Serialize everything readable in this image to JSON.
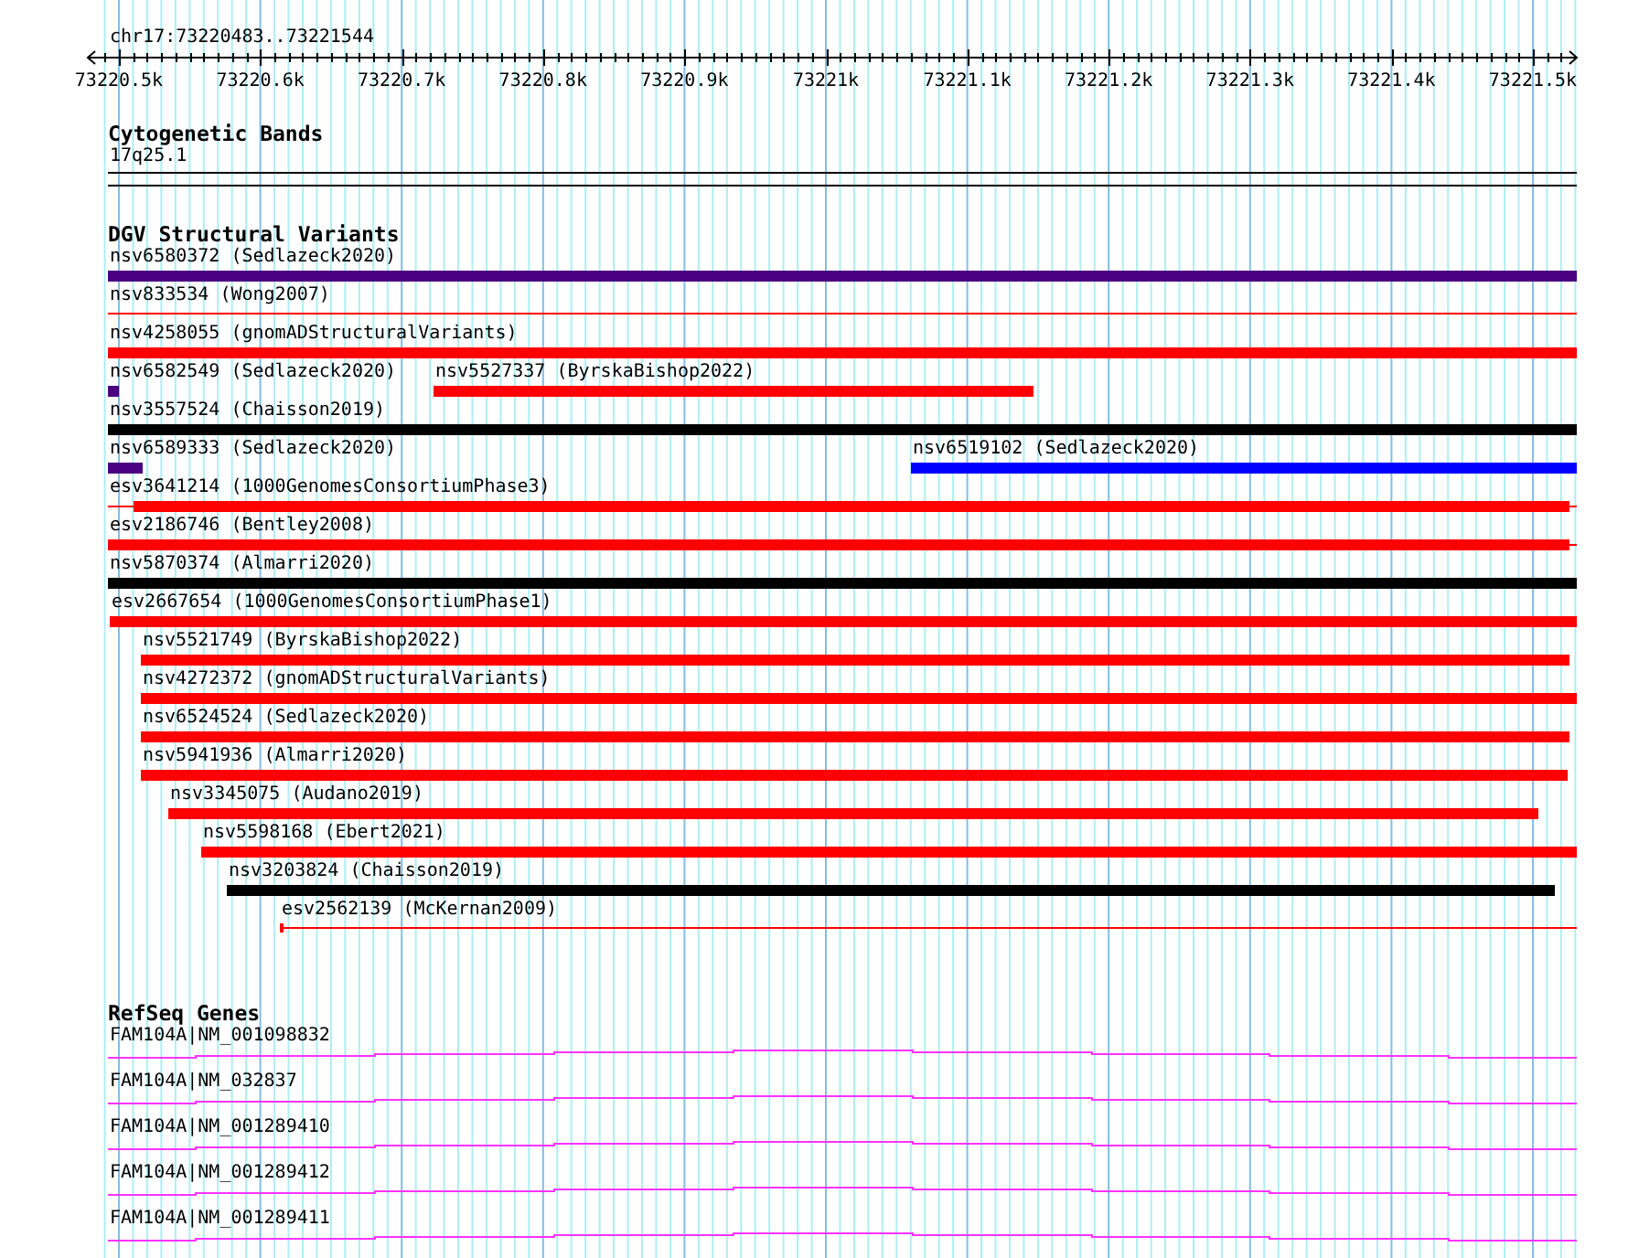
{
  "location": "chr17:73220483..73221544",
  "ruler": {
    "ticks": [
      "73220.5k",
      "73220.6k",
      "73220.7k",
      "73220.8k",
      "73220.9k",
      "73221k",
      "73221.1k",
      "73221.2k",
      "73221.3k",
      "73221.4k",
      "73221.5k"
    ]
  },
  "tracks": [
    {
      "kind": "bands",
      "title": "Cytogenetic Bands",
      "bands": [
        {
          "label": "17q25.1"
        }
      ]
    },
    {
      "kind": "variants",
      "title": "DGV Structural Variants",
      "rows": [
        {
          "features": [
            {
              "label": "nsv6580372 (Sedlazeck2020)",
              "kind": "bar",
              "color": "#4b0082"
            }
          ]
        },
        {
          "features": [
            {
              "label": "nsv833534 (Wong2007)",
              "kind": "line",
              "color": "#ff0000"
            }
          ]
        },
        {
          "features": [
            {
              "label": "nsv4258055 (gnomADStructuralVariants)",
              "kind": "bar",
              "color": "#ff0000"
            }
          ]
        },
        {
          "features": [
            {
              "label": "nsv6582549 (Sedlazeck2020)",
              "kind": "bar",
              "color": "#4b0082"
            },
            {
              "label": "nsv5527337 (ByrskaBishop2022)",
              "kind": "bar",
              "color": "#ff0000"
            }
          ]
        },
        {
          "features": [
            {
              "label": "nsv3557524 (Chaisson2019)",
              "kind": "bar",
              "color": "#000000"
            }
          ]
        },
        {
          "features": [
            {
              "label": "nsv6589333 (Sedlazeck2020)",
              "kind": "bar",
              "color": "#4b0082"
            },
            {
              "label": "nsv6519102 (Sedlazeck2020)",
              "kind": "bar",
              "color": "#0000ff"
            }
          ]
        },
        {
          "features": [
            {
              "label": "esv3641214 (1000GenomesConsortiumPhase3)",
              "kind": "bar",
              "color": "#ff0000"
            }
          ]
        },
        {
          "features": [
            {
              "label": "esv2186746 (Bentley2008)",
              "kind": "bar",
              "color": "#ff0000"
            }
          ]
        },
        {
          "features": [
            {
              "label": "nsv5870374 (Almarri2020)",
              "kind": "bar",
              "color": "#000000"
            }
          ]
        },
        {
          "features": [
            {
              "label": "esv2667654 (1000GenomesConsortiumPhase1)",
              "kind": "bar",
              "color": "#ff0000"
            }
          ]
        },
        {
          "features": [
            {
              "label": "nsv5521749 (ByrskaBishop2022)",
              "kind": "bar",
              "color": "#ff0000"
            }
          ]
        },
        {
          "features": [
            {
              "label": "nsv4272372 (gnomADStructuralVariants)",
              "kind": "bar",
              "color": "#ff0000"
            }
          ]
        },
        {
          "features": [
            {
              "label": "nsv6524524 (Sedlazeck2020)",
              "kind": "bar",
              "color": "#ff0000"
            }
          ]
        },
        {
          "features": [
            {
              "label": "nsv5941936 (Almarri2020)",
              "kind": "bar",
              "color": "#ff0000"
            }
          ]
        },
        {
          "features": [
            {
              "label": "nsv3345075 (Audano2019)",
              "kind": "bar",
              "color": "#ff0000"
            }
          ]
        },
        {
          "features": [
            {
              "label": "nsv5598168 (Ebert2021)",
              "kind": "bar",
              "color": "#ff0000"
            }
          ]
        },
        {
          "features": [
            {
              "label": "nsv3203824 (Chaisson2019)",
              "kind": "bar",
              "color": "#000000"
            }
          ]
        },
        {
          "features": [
            {
              "label": "esv2562139 (McKernan2009)",
              "kind": "line",
              "color": "#ff0000"
            }
          ]
        }
      ]
    },
    {
      "kind": "genes",
      "title": "RefSeq Genes",
      "genes": [
        {
          "label": "FAM104A|NM_001098832"
        },
        {
          "label": "FAM104A|NM_032837"
        },
        {
          "label": "FAM104A|NM_001289410"
        },
        {
          "label": "FAM104A|NM_001289412"
        },
        {
          "label": "FAM104A|NM_001289411"
        }
      ]
    }
  ]
}
